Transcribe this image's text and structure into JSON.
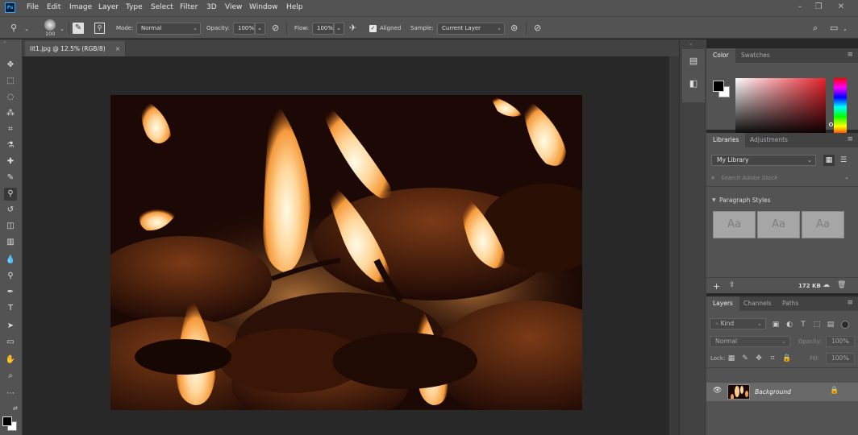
{
  "menubar": {
    "logo": "Ps",
    "items": [
      "File",
      "Edit",
      "Image",
      "Layer",
      "Type",
      "Select",
      "Filter",
      "3D",
      "View",
      "Window",
      "Help"
    ]
  },
  "options": {
    "brush_size": "100",
    "mode_label": "Mode:",
    "mode_value": "Normal",
    "opacity_label": "Opacity:",
    "opacity_value": "100%",
    "flow_label": "Flow:",
    "flow_value": "100%",
    "aligned_label": "Aligned",
    "aligned_checked": true,
    "sample_label": "Sample:",
    "sample_value": "Current Layer"
  },
  "document": {
    "tab_title": "lit1.jpg @ 12.5% (RGB/8)",
    "close_glyph": "×",
    "zoom": "12.5%"
  },
  "color_panel": {
    "tabs": [
      "Color",
      "Swatches"
    ],
    "foreground": "#000000",
    "background": "#ffffff"
  },
  "libraries_panel": {
    "tabs": [
      "Libraries",
      "Adjustments"
    ],
    "library_value": "My Library",
    "search_placeholder": "Search Adobe Stock",
    "section_title": "Paragraph Styles",
    "tiles": [
      "Aa",
      "Aa",
      "Aa"
    ],
    "size": "172 KB"
  },
  "layers_panel": {
    "tabs": [
      "Layers",
      "Channels",
      "Paths"
    ],
    "filter_value": "Kind",
    "blend_value": "Normal",
    "opacity_label": "Opacity:",
    "opacity_value": "100%",
    "lock_label": "Lock:",
    "fill_label": "Fill:",
    "fill_value": "100%",
    "layer_name": "Background"
  },
  "colors": {
    "chrome": "#535353",
    "dark": "#282828",
    "accent": "#31a8ff"
  }
}
